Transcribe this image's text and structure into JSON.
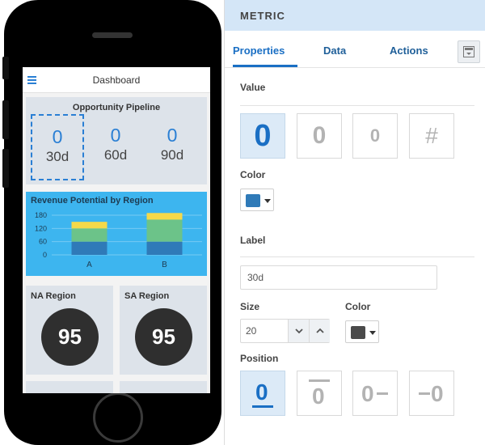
{
  "phone": {
    "app_title": "Dashboard",
    "pipeline": {
      "title": "Opportunity Pipeline",
      "metrics": [
        {
          "value": "0",
          "label": "30d"
        },
        {
          "value": "0",
          "label": "60d"
        },
        {
          "value": "0",
          "label": "90d"
        }
      ]
    },
    "revenue": {
      "title": "Revenue Potential by Region",
      "chart_data": {
        "type": "bar",
        "stacked": true,
        "categories": [
          "A",
          "B"
        ],
        "series": [
          {
            "values": [
              60,
              60
            ],
            "color": "#2f7ab8"
          },
          {
            "values": [
              60,
              100
            ],
            "color": "#6cc389"
          },
          {
            "values": [
              30,
              30
            ],
            "color": "#f5d94a"
          }
        ],
        "yticks": [
          "180",
          "120",
          "60",
          "0"
        ],
        "ylim": [
          0,
          180
        ],
        "grid": true
      }
    },
    "regions": [
      {
        "title": "NA Region",
        "value": "95"
      },
      {
        "title": "SA Region",
        "value": "95"
      }
    ]
  },
  "panel": {
    "header": "METRIC",
    "tabs": [
      {
        "label": "Properties",
        "active": true
      },
      {
        "label": "Data",
        "active": false
      },
      {
        "label": "Actions",
        "active": false
      }
    ],
    "value_section": {
      "label": "Value",
      "options": [
        "0",
        "0",
        "0",
        "#"
      ]
    },
    "color_section": {
      "label": "Color",
      "color": "#2f7ab8"
    },
    "label_section": {
      "label": "Label",
      "input_value": "30d"
    },
    "size_section": {
      "label": "Size",
      "value": "20"
    },
    "size_color": {
      "label": "Color",
      "color": "#4a4a4a"
    },
    "position_section": {
      "label": "Position",
      "options": [
        "0",
        "0",
        "0",
        "0"
      ]
    }
  },
  "icons": {
    "menu": "hamburger-icon",
    "tab_button": "panel-icon",
    "stepper_down": "chevron-down-icon",
    "stepper_up": "chevron-up-icon"
  }
}
